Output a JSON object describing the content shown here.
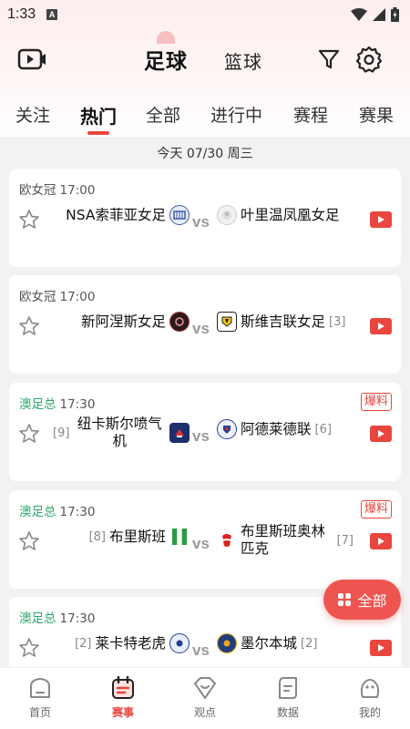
{
  "status": {
    "time": "1:33",
    "notice": "A"
  },
  "sports_tabs": {
    "active": "足球",
    "inactive": "篮球"
  },
  "category_tabs": [
    "关注",
    "热门",
    "全部",
    "进行中",
    "赛程",
    "赛果"
  ],
  "date": "今天 07/30 周三",
  "matches": [
    {
      "league": "欧女冠",
      "league_color": "#555555",
      "time": "17:00",
      "tag": "",
      "home": "NSA索菲亚女足",
      "home_rank": "",
      "away": "叶里温凤凰女足",
      "away_rank": ""
    },
    {
      "league": "欧女冠",
      "league_color": "#555555",
      "time": "17:00",
      "tag": "",
      "home": "新阿涅斯女足",
      "home_rank": "",
      "away": "斯维吉联女足",
      "away_rank": "[3]"
    },
    {
      "league": "澳足总",
      "league_color": "#2aa86a",
      "time": "17:30",
      "tag": "爆料",
      "home": "纽卡斯尔喷气机",
      "home_rank": "[9]",
      "away": "阿德莱德联",
      "away_rank": "[6]"
    },
    {
      "league": "澳足总",
      "league_color": "#2aa86a",
      "time": "17:30",
      "tag": "爆料",
      "home": "布里斯班",
      "home_rank": "[8]",
      "away": "布里斯班奥林匹克",
      "away_rank": "[7]"
    },
    {
      "league": "澳足总",
      "league_color": "#2aa86a",
      "time": "17:30",
      "tag": "",
      "home": "莱卡特老虎",
      "home_rank": "[2]",
      "away": "墨尔本城",
      "away_rank": "[2]"
    }
  ],
  "vs_label": "vs",
  "float_button": "全部",
  "bottom_nav": [
    "首页",
    "赛事",
    "观点",
    "数据",
    "我的"
  ],
  "colors": {
    "accent": "#e8463e",
    "league_green": "#2aa86a"
  }
}
